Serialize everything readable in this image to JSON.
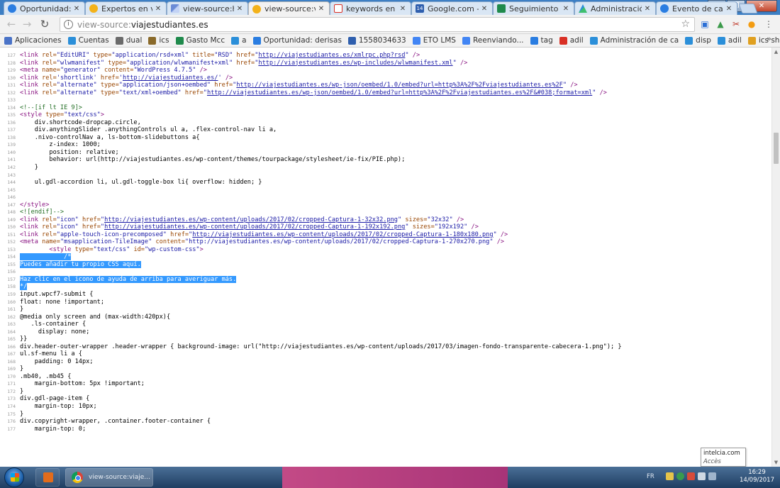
{
  "tabs": [
    {
      "title": "Oportunidad:",
      "icon": "blue-drop",
      "active": false
    },
    {
      "title": "Expertos en vi",
      "icon": "sun",
      "active": false
    },
    {
      "title": "view-source:ht",
      "icon": "wand",
      "active": false
    },
    {
      "title": "view-source:vi",
      "icon": "sun",
      "active": true
    },
    {
      "title": "keywords en e",
      "icon": "gmail",
      "active": false
    },
    {
      "title": "Google.com -",
      "icon": "cal",
      "active": false
    },
    {
      "title": "Seguimiento",
      "icon": "sheet",
      "active": false
    },
    {
      "title": "Administració",
      "icon": "admin",
      "active": false
    },
    {
      "title": "Evento de cal",
      "icon": "blue-drop",
      "active": false
    }
  ],
  "address_bar": {
    "url_prefix": "view-source:",
    "url_domain": "viajestudiantes.es"
  },
  "bookmarks": [
    {
      "label": "Aplicaciones",
      "color": "#4a73c7"
    },
    {
      "label": "Cuentas",
      "color": "#2b8fd9"
    },
    {
      "label": "dual",
      "color": "#6b6b6b"
    },
    {
      "label": "ics",
      "color": "#8a6a2a"
    },
    {
      "label": "Gasto Mcc",
      "color": "#1f8a4c"
    },
    {
      "label": "a",
      "color": "#2b8fd9"
    },
    {
      "label": "Oportunidad: derisas",
      "color": "#2a7de1"
    },
    {
      "label": "1558034633",
      "color": "#2f5fae"
    },
    {
      "label": "ETO LMS",
      "color": "#4285f4"
    },
    {
      "label": "Reenviando...",
      "color": "#4285f4"
    },
    {
      "label": "tag",
      "color": "#2a7de1"
    },
    {
      "label": "adil",
      "color": "#d93025"
    },
    {
      "label": "Administración de ca",
      "color": "#2b8fd9"
    },
    {
      "label": "disp",
      "color": "#2b8fd9"
    },
    {
      "label": "adil",
      "color": "#2b8fd9"
    },
    {
      "label": "ics shopping",
      "color": "#e0a020"
    }
  ],
  "bookmarks_more": "»",
  "source_lines": [
    {
      "n": "127",
      "html": "<span class=\"tag\">&lt;link</span> <span class=\"attr\">rel=</span><span class=\"val\">\"EditURI\"</span> <span class=\"attr\">type=</span><span class=\"val\">\"application/rsd+xml\"</span> <span class=\"attr\">title=</span><span class=\"val\">\"RSD\"</span> <span class=\"attr\">href=</span><span class=\"val\">\"</span><span class=\"lnk\">http://viajestudiantes.es/xmlrpc.php?rsd</span><span class=\"val\">\"</span> <span class=\"tag\">/&gt;</span>"
    },
    {
      "n": "128",
      "html": "<span class=\"tag\">&lt;link</span> <span class=\"attr\">rel=</span><span class=\"val\">\"wlwmanifest\"</span> <span class=\"attr\">type=</span><span class=\"val\">\"application/wlwmanifest+xml\"</span> <span class=\"attr\">href=</span><span class=\"val\">\"</span><span class=\"lnk\">http://viajestudiantes.es/wp-includes/wlwmanifest.xml</span><span class=\"val\">\"</span> <span class=\"tag\">/&gt;</span>"
    },
    {
      "n": "129",
      "html": "<span class=\"tag\">&lt;meta</span> <span class=\"attr\">name=</span><span class=\"val\">\"generator\"</span> <span class=\"attr\">content=</span><span class=\"val\">\"WordPress 4.7.5\"</span> <span class=\"tag\">/&gt;</span>"
    },
    {
      "n": "130",
      "html": "<span class=\"tag\">&lt;link</span> <span class=\"attr\">rel=</span><span class=\"val\">'shortlink'</span> <span class=\"attr\">href=</span><span class=\"val\">'</span><span class=\"lnk\">http://viajestudiantes.es/</span><span class=\"val\">'</span> <span class=\"tag\">/&gt;</span>"
    },
    {
      "n": "131",
      "html": "<span class=\"tag\">&lt;link</span> <span class=\"attr\">rel=</span><span class=\"val\">\"alternate\"</span> <span class=\"attr\">type=</span><span class=\"val\">\"application/json+oembed\"</span> <span class=\"attr\">href=</span><span class=\"val\">\"</span><span class=\"lnk\">http://viajestudiantes.es/wp-json/oembed/1.0/embed?url=http%3A%2F%2Fviajestudiantes.es%2F</span><span class=\"val\">\"</span> <span class=\"tag\">/&gt;</span>"
    },
    {
      "n": "132",
      "html": "<span class=\"tag\">&lt;link</span> <span class=\"attr\">rel=</span><span class=\"val\">\"alternate\"</span> <span class=\"attr\">type=</span><span class=\"val\">\"text/xml+oembed\"</span> <span class=\"attr\">href=</span><span class=\"val\">\"</span><span class=\"lnk\">http://viajestudiantes.es/wp-json/oembed/1.0/embed?url=http%3A%2F%2Fviajestudiantes.es%2F&amp;#038;format=xml</span><span class=\"val\">\"</span> <span class=\"tag\">/&gt;</span>"
    },
    {
      "n": "133",
      "html": ""
    },
    {
      "n": "134",
      "html": "<span class=\"cmt\">&lt;!--[if lt IE 9]&gt;</span>"
    },
    {
      "n": "135",
      "html": "<span class=\"tag\">&lt;style</span> <span class=\"attr\">type=</span><span class=\"val\">\"text/css\"</span><span class=\"tag\">&gt;</span>"
    },
    {
      "n": "136",
      "html": "    div.shortcode-dropcap.circle,"
    },
    {
      "n": "137",
      "html": "    div.anythingSlider .anythingControls ul a, .flex-control-nav li a,"
    },
    {
      "n": "138",
      "html": "    .nivo-controlNav a, ls-bottom-slidebuttons a{"
    },
    {
      "n": "139",
      "html": "        z-index: 1000;"
    },
    {
      "n": "140",
      "html": "        position: relative;"
    },
    {
      "n": "141",
      "html": "        behavior: url(http://viajestudiantes.es/wp-content/themes/tourpackage/stylesheet/ie-fix/PIE.php);"
    },
    {
      "n": "142",
      "html": "    }"
    },
    {
      "n": "143",
      "html": ""
    },
    {
      "n": "144",
      "html": "    ul.gdl-accordion li, ul.gdl-toggle-box li{ overflow: hidden; }"
    },
    {
      "n": "145",
      "html": ""
    },
    {
      "n": "146",
      "html": ""
    },
    {
      "n": "147",
      "html": "<span class=\"tag\">&lt;/style&gt;</span>"
    },
    {
      "n": "148",
      "html": "<span class=\"cmt\">&lt;![endif]--&gt;</span>"
    },
    {
      "n": "149",
      "html": "<span class=\"tag\">&lt;link</span> <span class=\"attr\">rel=</span><span class=\"val\">\"icon\"</span> <span class=\"attr\">href=</span><span class=\"val\">\"</span><span class=\"lnk\">http://viajestudiantes.es/wp-content/uploads/2017/02/cropped-Captura-1-32x32.png</span><span class=\"val\">\"</span> <span class=\"attr\">sizes=</span><span class=\"val\">\"32x32\"</span> <span class=\"tag\">/&gt;</span>"
    },
    {
      "n": "150",
      "html": "<span class=\"tag\">&lt;link</span> <span class=\"attr\">rel=</span><span class=\"val\">\"icon\"</span> <span class=\"attr\">href=</span><span class=\"val\">\"</span><span class=\"lnk\">http://viajestudiantes.es/wp-content/uploads/2017/02/cropped-Captura-1-192x192.png</span><span class=\"val\">\"</span> <span class=\"attr\">sizes=</span><span class=\"val\">\"192x192\"</span> <span class=\"tag\">/&gt;</span>"
    },
    {
      "n": "151",
      "html": "<span class=\"tag\">&lt;link</span> <span class=\"attr\">rel=</span><span class=\"val\">\"apple-touch-icon-precomposed\"</span> <span class=\"attr\">href=</span><span class=\"val\">\"</span><span class=\"lnk\">http://viajestudiantes.es/wp-content/uploads/2017/02/cropped-Captura-1-180x180.png</span><span class=\"val\">\"</span> <span class=\"tag\">/&gt;</span>"
    },
    {
      "n": "152",
      "html": "<span class=\"tag\">&lt;meta</span> <span class=\"attr\">name=</span><span class=\"val\">\"msapplication-TileImage\"</span> <span class=\"attr\">content=</span><span class=\"val\">\"http://viajestudiantes.es/wp-content/uploads/2017/02/cropped-Captura-1-270x270.png\"</span> <span class=\"tag\">/&gt;</span>"
    },
    {
      "n": "153",
      "html": "        <span class=\"tag\">&lt;style</span> <span class=\"attr\">type=</span><span class=\"val\">\"text/css\"</span> <span class=\"attr\">id=</span><span class=\"val\">\"wp-custom-css\"</span><span class=\"tag\">&gt;</span>"
    },
    {
      "n": "154",
      "html": "            <span class=\"code-sel\">/*</span>",
      "sel": true,
      "indent": "            "
    },
    {
      "n": "155",
      "html": "Puedes añadir tu propio CSS aquí.",
      "sel": true
    },
    {
      "n": "156",
      "html": "",
      "sel": false
    },
    {
      "n": "157",
      "html": "Haz clic en el icono de ayuda de arriba para averiguar más.",
      "sel": true
    },
    {
      "n": "158",
      "html": "*/",
      "sel": true
    },
    {
      "n": "159",
      "html": "input.wpcf7-submit {"
    },
    {
      "n": "160",
      "html": "float: none !important;"
    },
    {
      "n": "161",
      "html": "}"
    },
    {
      "n": "162",
      "html": "@media only screen and (max-width:420px){"
    },
    {
      "n": "163",
      "html": "   .ls-container {"
    },
    {
      "n": "164",
      "html": "     display: none;"
    },
    {
      "n": "165",
      "html": "}}"
    },
    {
      "n": "166",
      "html": "div.header-outer-wrapper .header-wrapper { background-image: url(\"http://viajestudiantes.es/wp-content/uploads/2017/03/imagen-fondo-transparente-cabecera-1.png\"); }"
    },
    {
      "n": "167",
      "html": "ul.sf-menu li a {"
    },
    {
      "n": "168",
      "html": "    padding: 0 14px;"
    },
    {
      "n": "169",
      "html": "}"
    },
    {
      "n": "170",
      "html": ".mb40, .mb45 {"
    },
    {
      "n": "171",
      "html": "    margin-bottom: 5px !important;"
    },
    {
      "n": "172",
      "html": "}"
    },
    {
      "n": "173",
      "html": "div.gdl-page-item {"
    },
    {
      "n": "174",
      "html": "    margin-top: 10px;"
    },
    {
      "n": "175",
      "html": "}"
    },
    {
      "n": "176",
      "html": "div.copyright-wrapper, .container.footer-container {"
    },
    {
      "n": "177",
      "html": "    margin-top: 0;"
    }
  ],
  "tooltip": {
    "title": "intelcia.com",
    "subtitle": "Accès Internet"
  },
  "taskbar": {
    "chrome_task_label": "view-source:viaje...",
    "language": "FR",
    "time": "16:29",
    "date": "14/09/2017"
  }
}
